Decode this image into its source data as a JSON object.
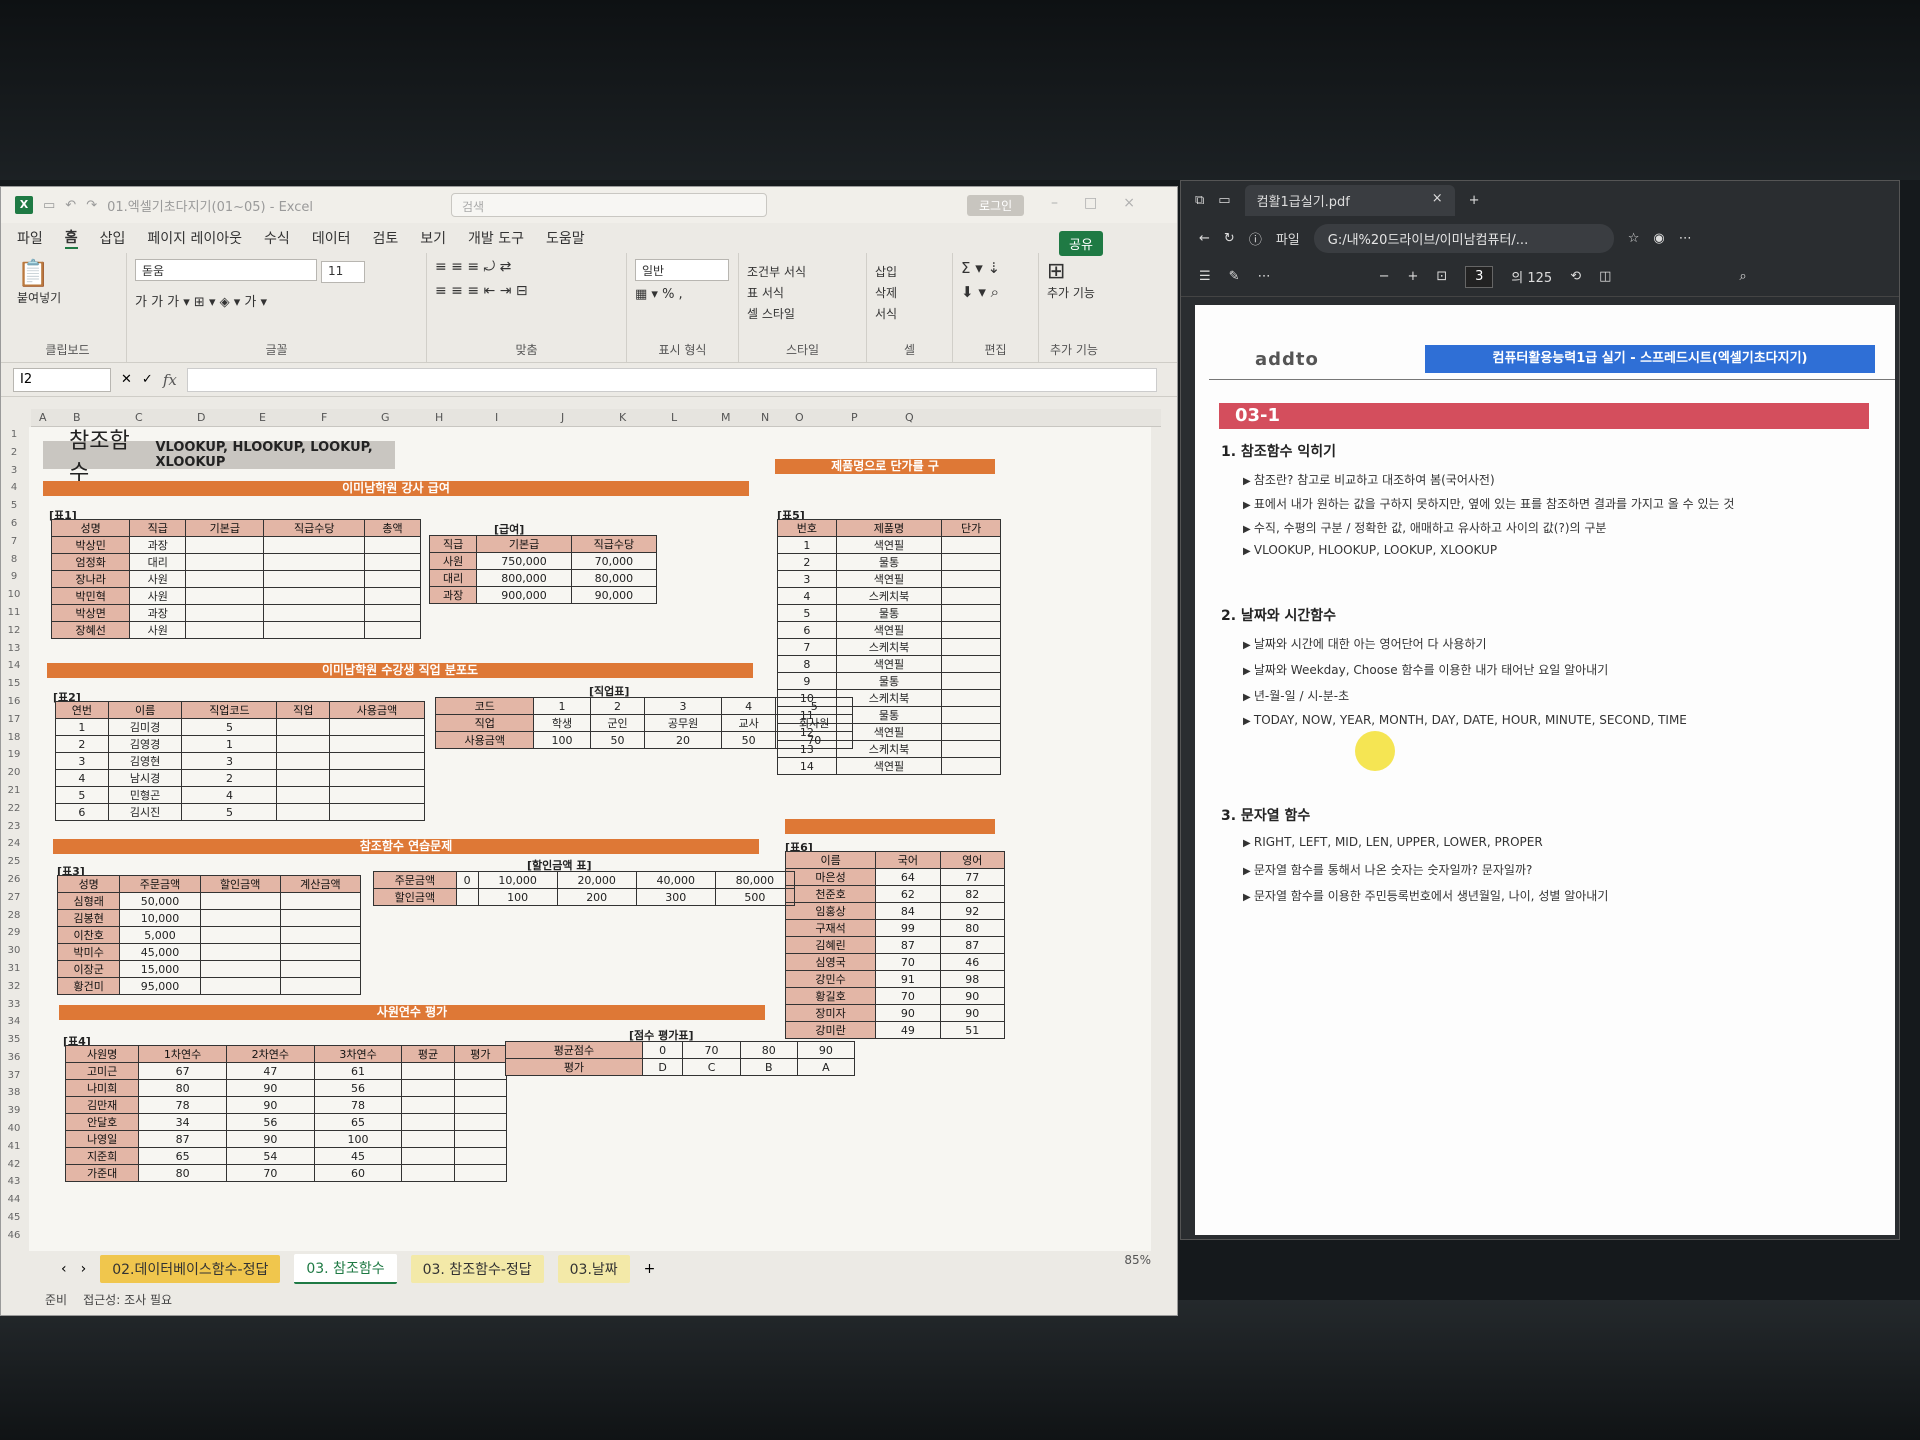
{
  "excel": {
    "title": "01.엑셀기초다지기(01~05) - Excel",
    "search": "검색",
    "login": "로그인",
    "share": "공유",
    "menu": [
      "파일",
      "홈",
      "삽입",
      "페이지 레이아웃",
      "수식",
      "데이터",
      "검토",
      "보기",
      "개발 도구",
      "도움말"
    ],
    "ribbon": {
      "paste": "붙여넣기",
      "clipboard": "클립보드",
      "font_name": "돋움",
      "font_size": "11",
      "font_group": "글꼴",
      "align_group": "맞춤",
      "number_format": "일반",
      "number_group": "표시 형식",
      "cond_format": "조건부 서식",
      "table_format": "표 서식",
      "cell_style": "셀 스타일",
      "style_group": "스타일",
      "insert": "삽입",
      "delete": "삭제",
      "format": "서식",
      "cell_group": "셀",
      "edit_group": "편집",
      "addin": "추가 기능",
      "addin_group": "추가 기능"
    },
    "name_box": "I2",
    "fx": "fx",
    "columns": [
      "A",
      "B",
      "C",
      "D",
      "E",
      "F",
      "G",
      "H",
      "I",
      "J",
      "K",
      "L",
      "M",
      "N",
      "O",
      "P",
      "Q"
    ],
    "rows": [
      "1",
      "2",
      "3",
      "4",
      "5",
      "6",
      "7",
      "8",
      "9",
      "10",
      "11",
      "12",
      "13",
      "14",
      "15",
      "16",
      "17",
      "18",
      "19",
      "20",
      "21",
      "22",
      "23",
      "24",
      "25",
      "26",
      "27",
      "28",
      "29",
      "30",
      "31",
      "32",
      "33",
      "34",
      "35",
      "36",
      "37",
      "38",
      "39",
      "40",
      "41",
      "42",
      "43",
      "44",
      "45",
      "46"
    ],
    "sheet": {
      "title": "참조함수",
      "subtitle": "VLOOKUP, HLOOKUP, LOOKUP, XLOOKUP",
      "banner1": "이미남학원 강사 급여",
      "banner2": "이미남학원 수강생 직업 분포도",
      "banner3": "참조함수 연습문제",
      "banner4": "사원연수 평가",
      "banner5": "제품명으로 단가를 구",
      "t1_label": "[표1]",
      "t1_head": [
        "성명",
        "직급",
        "기본급",
        "직급수당",
        "총액"
      ],
      "t1_rows": [
        [
          "박상민",
          "과장",
          "",
          "",
          ""
        ],
        [
          "엄정화",
          "대리",
          "",
          "",
          ""
        ],
        [
          "장나라",
          "사원",
          "",
          "",
          ""
        ],
        [
          "박민혁",
          "사원",
          "",
          "",
          ""
        ],
        [
          "박상면",
          "과장",
          "",
          "",
          ""
        ],
        [
          "장혜선",
          "사원",
          "",
          "",
          ""
        ]
      ],
      "pay_label": "[급여]",
      "pay_head": [
        "직급",
        "기본급",
        "직급수당"
      ],
      "pay_rows": [
        [
          "사원",
          "750,000",
          "70,000"
        ],
        [
          "대리",
          "800,000",
          "80,000"
        ],
        [
          "과장",
          "900,000",
          "90,000"
        ]
      ],
      "t2_label": "[표2]",
      "t2_head": [
        "연번",
        "이름",
        "직업코드",
        "직업",
        "사용금액"
      ],
      "t2_rows": [
        [
          "1",
          "김미경",
          "5",
          "",
          ""
        ],
        [
          "2",
          "김영경",
          "1",
          "",
          ""
        ],
        [
          "3",
          "김영현",
          "3",
          "",
          ""
        ],
        [
          "4",
          "남시경",
          "2",
          "",
          ""
        ],
        [
          "5",
          "민형곤",
          "4",
          "",
          ""
        ],
        [
          "6",
          "김시진",
          "5",
          "",
          ""
        ]
      ],
      "job_label": "[직업표]",
      "job_code": [
        "코드",
        "1",
        "2",
        "3",
        "4",
        "5"
      ],
      "job_name": [
        "직업",
        "학생",
        "군인",
        "공무원",
        "교사",
        "회사원"
      ],
      "job_amt": [
        "사용금액",
        "100",
        "50",
        "20",
        "50",
        "70"
      ],
      "t3_label": "[표3]",
      "t3_head": [
        "성명",
        "주문금액",
        "할인금액",
        "계산금액"
      ],
      "t3_rows": [
        [
          "심형래",
          "50,000",
          "",
          ""
        ],
        [
          "김봉현",
          "10,000",
          "",
          ""
        ],
        [
          "이찬호",
          "5,000",
          "",
          ""
        ],
        [
          "박미수",
          "45,000",
          "",
          ""
        ],
        [
          "이장군",
          "15,000",
          "",
          ""
        ],
        [
          "황건미",
          "95,000",
          "",
          ""
        ]
      ],
      "disc_label": "[할인금액 표]",
      "disc_order": [
        "주문금액",
        "0",
        "10,000",
        "20,000",
        "40,000",
        "80,000"
      ],
      "disc_amt": [
        "할인금액",
        "",
        "100",
        "200",
        "300",
        "500"
      ],
      "t4_label": "[표4]",
      "t4_head": [
        "사원명",
        "1차연수",
        "2차연수",
        "3차연수",
        "평균",
        "평가"
      ],
      "t4_rows": [
        [
          "고미근",
          "67",
          "47",
          "61",
          "",
          ""
        ],
        [
          "나미희",
          "80",
          "90",
          "56",
          "",
          ""
        ],
        [
          "김만재",
          "78",
          "90",
          "78",
          "",
          ""
        ],
        [
          "안달호",
          "34",
          "56",
          "65",
          "",
          ""
        ],
        [
          "나영일",
          "87",
          "90",
          "100",
          "",
          ""
        ],
        [
          "지준희",
          "65",
          "54",
          "45",
          "",
          ""
        ],
        [
          "가준대",
          "80",
          "70",
          "60",
          "",
          ""
        ]
      ],
      "score_label": "[점수 평가표]",
      "score_avg": [
        "평균점수",
        "0",
        "70",
        "80",
        "90"
      ],
      "score_grade": [
        "평가",
        "D",
        "C",
        "B",
        "A"
      ],
      "t5_label": "[표5]",
      "t5_head": [
        "번호",
        "제품명",
        "단가"
      ],
      "t5_rows": [
        [
          "1",
          "색연필",
          ""
        ],
        [
          "2",
          "물통",
          ""
        ],
        [
          "3",
          "색연필",
          ""
        ],
        [
          "4",
          "스케치북",
          ""
        ],
        [
          "5",
          "물통",
          ""
        ],
        [
          "6",
          "색연필",
          ""
        ],
        [
          "7",
          "스케치북",
          ""
        ],
        [
          "8",
          "색연필",
          ""
        ],
        [
          "9",
          "물통",
          ""
        ],
        [
          "10",
          "스케치북",
          ""
        ],
        [
          "11",
          "물통",
          ""
        ],
        [
          "12",
          "색연필",
          ""
        ],
        [
          "13",
          "스케치북",
          ""
        ],
        [
          "14",
          "색연필",
          ""
        ]
      ],
      "t6_label": "[표6]",
      "t6_head": [
        "이름",
        "국어",
        "영어"
      ],
      "t6_rows": [
        [
          "마은성",
          "64",
          "77"
        ],
        [
          "천준호",
          "62",
          "82"
        ],
        [
          "임홍상",
          "84",
          "92"
        ],
        [
          "구재석",
          "99",
          "80"
        ],
        [
          "김혜린",
          "87",
          "87"
        ],
        [
          "심영국",
          "70",
          "46"
        ],
        [
          "강민수",
          "91",
          "98"
        ],
        [
          "황길호",
          "70",
          "90"
        ],
        [
          "장미자",
          "90",
          "90"
        ],
        [
          "강미란",
          "49",
          "51"
        ]
      ]
    },
    "tabs": [
      "02.데이터베이스함수-정답",
      "03. 참조함수",
      "03. 참조함수-정답",
      "03.날짜"
    ],
    "status": {
      "ready": "준비",
      "access": "접근성: 조사 필요",
      "zoom": "85%"
    }
  },
  "pdf": {
    "tab_title": "컴활1급실기.pdf",
    "file_label": "파일",
    "address": "G:/내%20드라이브/이미남컴퓨터/...",
    "page": "3",
    "page_total": "의 125",
    "brand": "addto",
    "header_band": "컴퓨터활용능력1급 실기 - 스프레드시트(엑셀기초다지기)",
    "section_band": "03-1",
    "sec1": "1. 참조함수 익히기",
    "sec1_items": [
      "참조란? 참고로 비교하고 대조하여 봄(국어사전)",
      "표에서 내가 원하는 값을 구하지 못하지만, 옆에 있는 표를 참조하면 결과를 가지고 올 수 있는 것",
      "수직, 수평의 구분 / 정확한 값, 애매하고 유사하고 사이의 값(?)의 구분",
      "VLOOKUP, HLOOKUP, LOOKUP, XLOOKUP"
    ],
    "sec2": "2. 날짜와 시간함수",
    "sec2_items": [
      "날짜와 시간에 대한 아는 영어단어 다 사용하기",
      "날짜와 Weekday, Choose 함수를 이용한 내가 태어난 요일 알아내기",
      "년-월-일 / 시-분-초",
      "TODAY, NOW, YEAR, MONTH, DAY, DATE, HOUR, MINUTE, SECOND, TIME"
    ],
    "sec3": "3. 문자열 함수",
    "sec3_items": [
      "RIGHT, LEFT, MID, LEN, UPPER, LOWER, PROPER",
      "문자열 함수를 통해서 나온 숫자는 숫자일까? 문자일까?",
      "문자열 함수를 이용한 주민등록번호에서 생년월일, 나이, 성별 알아내기"
    ]
  }
}
